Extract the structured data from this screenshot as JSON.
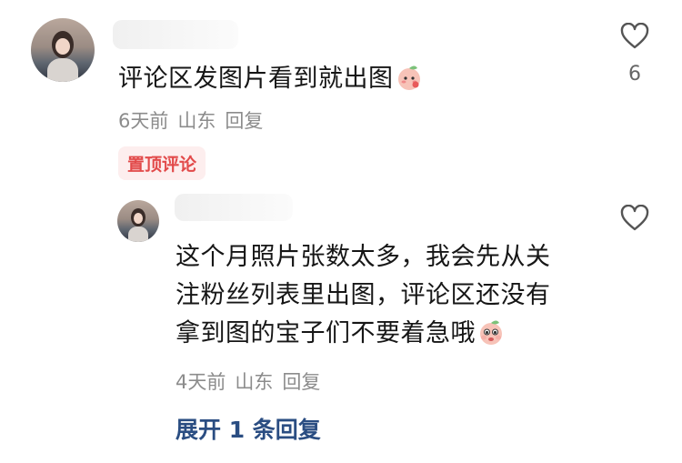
{
  "comment": {
    "text": "评论区发图片看到就出图",
    "emoji": "peach-blush-emoji",
    "time": "6天前",
    "location": "山东",
    "reply_label": "回复",
    "pin_badge": "置顶评论",
    "like_count": "6"
  },
  "reply": {
    "lines": [
      "这个月照片张数太多，我会先从关",
      "注粉丝列表里出图，评论区还没有",
      "拿到图的宝子们不要着急哦"
    ],
    "emoji": "peach-pleading-emoji",
    "time": "4天前",
    "location": "山东",
    "reply_label": "回复"
  },
  "expand_label": "展开 1 条回复",
  "colors": {
    "pin_bg": "#fdeeee",
    "pin_text": "#e24a4a",
    "link": "#2a4d82",
    "meta": "#8c8c8c"
  }
}
